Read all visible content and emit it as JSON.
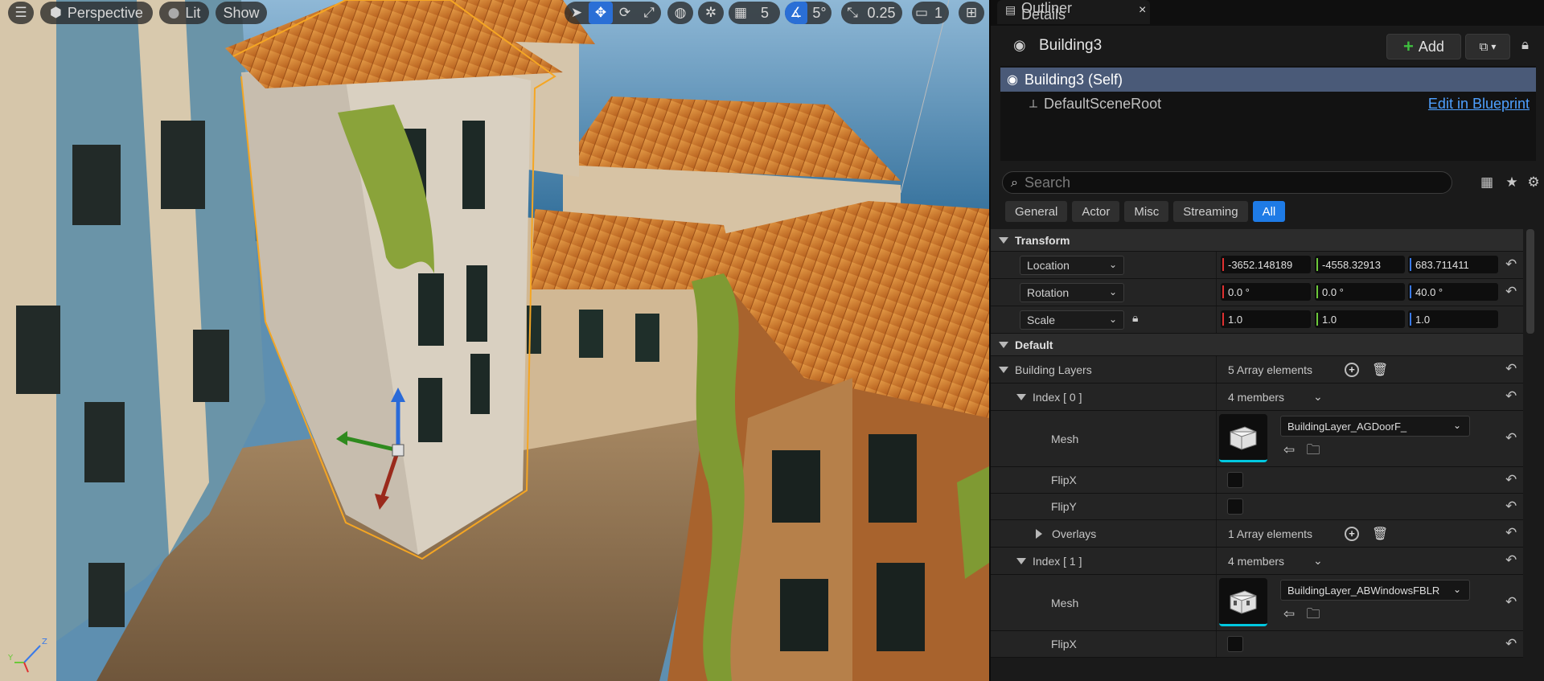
{
  "viewport": {
    "toolbar": {
      "menu_icon": "hamburger-icon",
      "perspective_label": "Perspective",
      "lit_label": "Lit",
      "show_label": "Show",
      "grid_snap_value": "5",
      "rotation_snap_value": "5°",
      "scale_snap_value": "0.25",
      "camera_speed_value": "1"
    }
  },
  "outliner": {
    "tabs": [
      {
        "label": "Outliner"
      },
      {
        "label": "Details"
      }
    ],
    "close_icon": "×"
  },
  "details": {
    "actor_name": "Building3",
    "add_label": "Add",
    "components": [
      {
        "label": "Building3 (Self)",
        "selected": true
      },
      {
        "label": "DefaultSceneRoot",
        "selected": false
      }
    ],
    "edit_blueprint_label": "Edit in Blueprint",
    "search": {
      "placeholder": "Search",
      "value": ""
    },
    "filters": [
      {
        "label": "General",
        "active": false
      },
      {
        "label": "Actor",
        "active": false
      },
      {
        "label": "Misc",
        "active": false
      },
      {
        "label": "Streaming",
        "active": false
      },
      {
        "label": "All",
        "active": true
      }
    ],
    "transform": {
      "category": "Transform",
      "location": {
        "label": "Location",
        "x": "-3652.148189",
        "y": "-4558.32913",
        "z": "683.711411"
      },
      "rotation": {
        "label": "Rotation",
        "x": "0.0 °",
        "y": "0.0 °",
        "z": "40.0 °"
      },
      "scale": {
        "label": "Scale",
        "x": "1.0",
        "y": "1.0",
        "z": "1.0"
      }
    },
    "default": {
      "category": "Default",
      "building_layers": {
        "label": "Building Layers",
        "value": "5 Array elements",
        "index0": {
          "label": "Index [ 0 ]",
          "value": "4 members",
          "mesh_label": "Mesh",
          "mesh_value": "BuildingLayer_AGDoorF_",
          "flipx_label": "FlipX",
          "flipy_label": "FlipY",
          "overlays_label": "Overlays",
          "overlays_value": "1 Array elements"
        },
        "index1": {
          "label": "Index [ 1 ]",
          "value": "4 members",
          "mesh_label": "Mesh",
          "mesh_value": "BuildingLayer_ABWindowsFBLR",
          "flipx_label": "FlipX"
        }
      }
    }
  },
  "colors": {
    "accent": "#1e7be6",
    "selection": "#4a5a78",
    "link": "#4ea0ff",
    "axis_x": "#e03030",
    "axis_y": "#6cc83a",
    "axis_z": "#3a7ae8",
    "selection_outline": "#f5a623"
  }
}
